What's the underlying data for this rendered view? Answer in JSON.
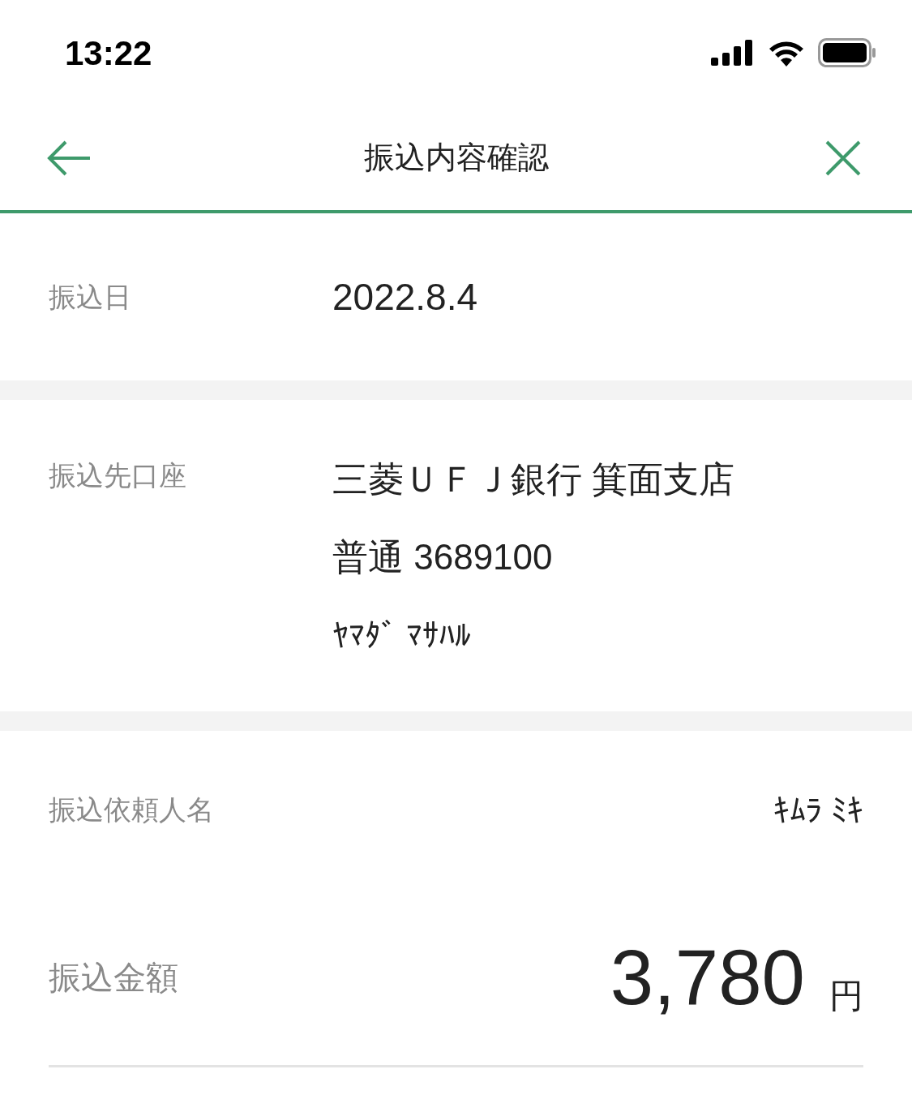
{
  "status_bar": {
    "time": "13:22"
  },
  "header": {
    "title": "振込内容確認"
  },
  "transfer_date": {
    "label": "振込日",
    "value": "2022.8.4"
  },
  "destination": {
    "label": "振込先口座",
    "bank": "三菱ＵＦＪ銀行 箕面支店",
    "account": "普通 3689100",
    "holder": "ﾔﾏﾀﾞ ﾏｻﾊﾙ"
  },
  "sender": {
    "label": "振込依頼人名",
    "value": "ｷﾑﾗ ﾐｷ"
  },
  "amount": {
    "label": "振込金額",
    "value": "3,780",
    "unit": "円"
  }
}
